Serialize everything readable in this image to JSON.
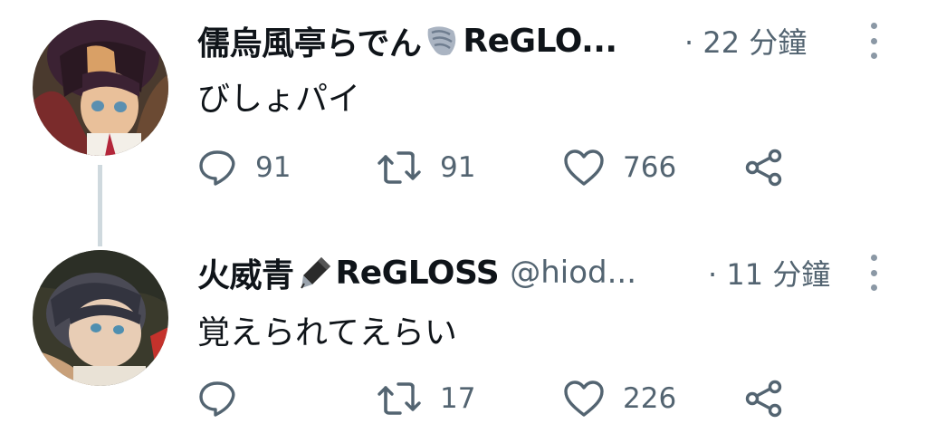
{
  "tweets": [
    {
      "display_name": "儒烏風亭らでん",
      "badge_icon": "shell-emoji-icon",
      "group": "ReGLO...",
      "handle": "",
      "time": "· 22 分鐘",
      "text": "びしょパイ",
      "reply_count": "91",
      "retweet_count": "91",
      "like_count": "766"
    },
    {
      "display_name": "火威青",
      "badge_icon": "fountain-pen-emoji-icon",
      "group": "ReGLOSS",
      "handle": "@hiod...",
      "time": "· 11 分鐘",
      "text": "覚えられてえらい",
      "reply_count": "",
      "retweet_count": "17",
      "like_count": "226"
    }
  ],
  "colors": {
    "secondary_text": "#536471",
    "primary_text": "#0f1419",
    "thread_line": "#cfd9de"
  }
}
